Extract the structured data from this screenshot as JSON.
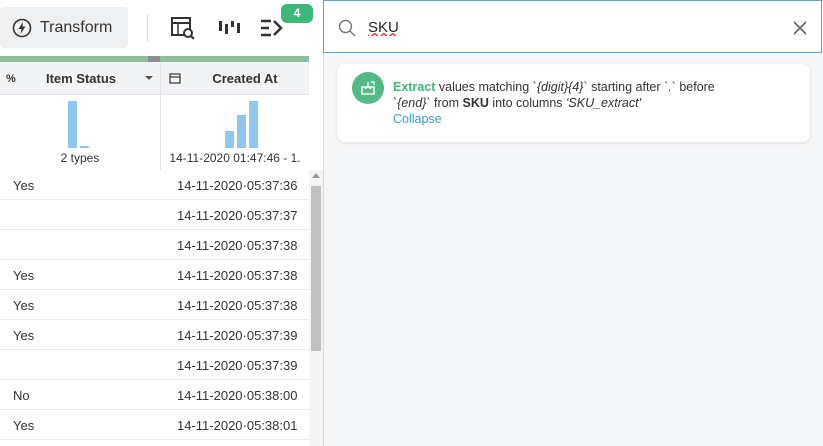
{
  "toolbar": {
    "transform_label": "Transform",
    "notification_count": "4"
  },
  "grid": {
    "columns": [
      {
        "name": "Item Status",
        "type_icon": "boolean-type-icon"
      },
      {
        "name": "Created At",
        "type_icon": "calendar-type-icon"
      }
    ],
    "histograms": {
      "item_status_label": "2 types",
      "created_at_label": "14-11-2020 01:47:46 - 1."
    },
    "rows": [
      {
        "status": "Yes",
        "created": "14-11-2020·05:37:36"
      },
      {
        "status": "",
        "created": "14-11-2020·05:37:37"
      },
      {
        "status": "",
        "created": "14-11-2020·05:37:38"
      },
      {
        "status": "Yes",
        "created": "14-11-2020·05:37:38"
      },
      {
        "status": "Yes",
        "created": "14-11-2020·05:37:38"
      },
      {
        "status": "Yes",
        "created": "14-11-2020·05:37:39"
      },
      {
        "status": "",
        "created": "14-11-2020·05:37:39"
      },
      {
        "status": "No",
        "created": "14-11-2020·05:38:00"
      },
      {
        "status": "Yes",
        "created": "14-11-2020·05:38:01"
      }
    ]
  },
  "search": {
    "value": "SKU",
    "clear_icon": "close-icon"
  },
  "suggestion": {
    "keyword": "Extract",
    "t1": " values matching ",
    "pattern": "`{digit}{4}`",
    "t2": " starting after ",
    "after": "`.`",
    "t3": " before",
    "before": "`{end}`",
    "t4": " from ",
    "source": "SKU",
    "t5": " into columns ",
    "target": "'SKU_extract'",
    "collapse_label": "Collapse"
  },
  "colors": {
    "accent_green": "#3cb878",
    "link_blue": "#3a9ad9",
    "histogram_blue": "#8cc8ee"
  }
}
